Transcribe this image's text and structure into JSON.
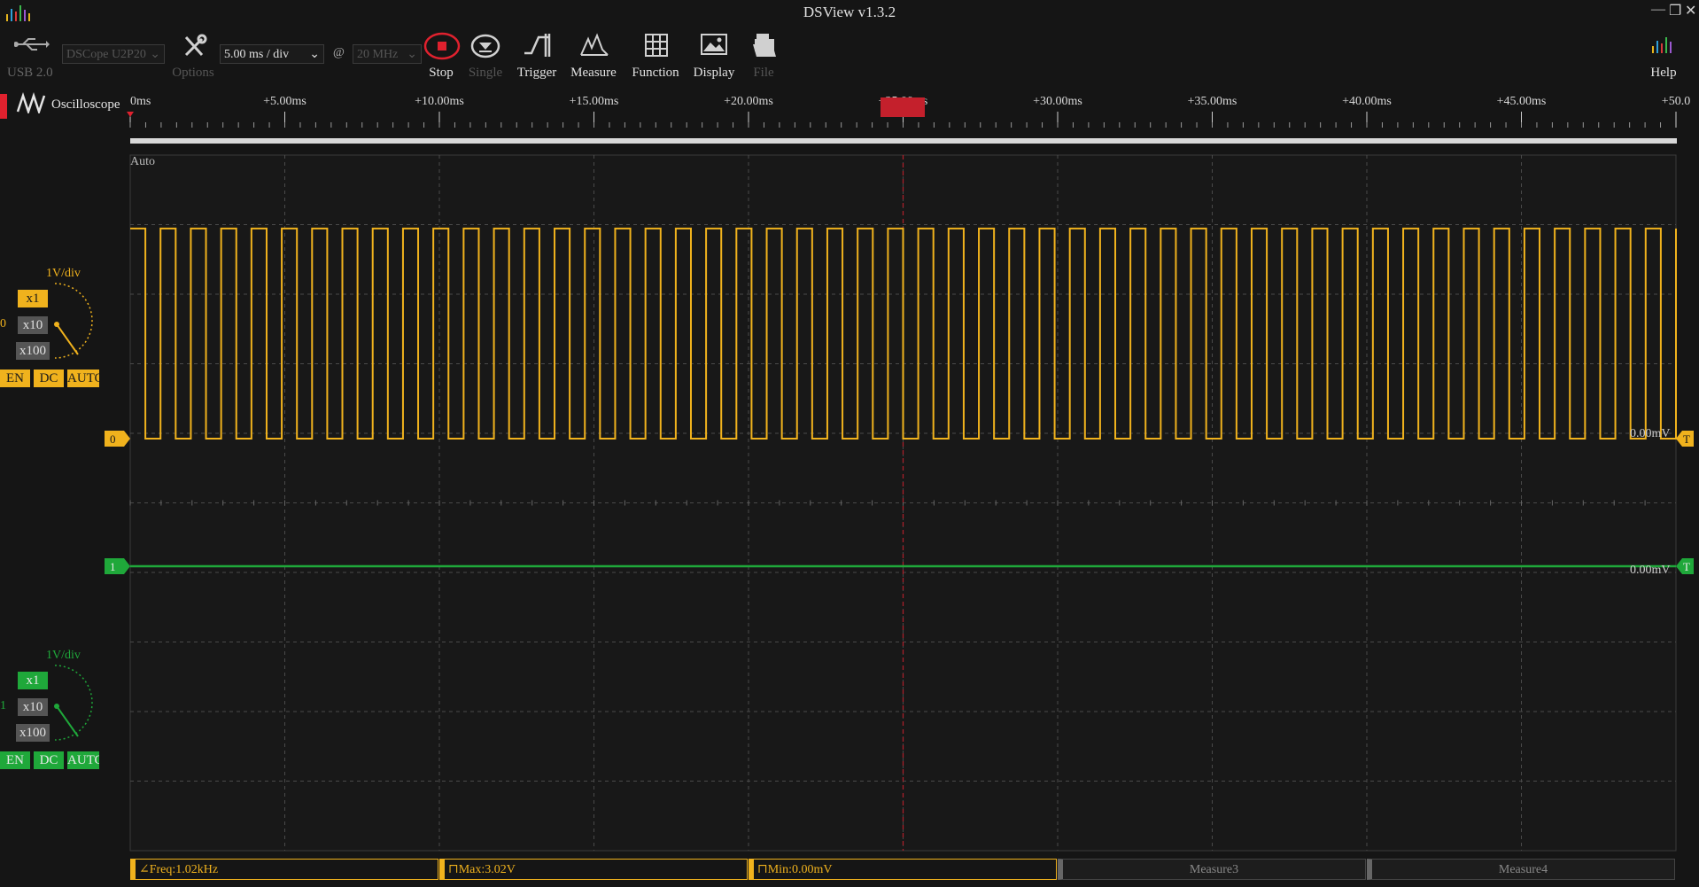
{
  "window": {
    "title": "DSView v1.3.2"
  },
  "toolbar": {
    "usb_label": "USB 2.0",
    "device": "DSCope U2P20",
    "timebase": "5.00 ms / div",
    "at": "@",
    "bandwidth": "20 MHz",
    "options_label": "Options",
    "stop_label": "Stop",
    "single_label": "Single",
    "trigger_label": "Trigger",
    "measure_label": "Measure",
    "function_label": "Function",
    "display_label": "Display",
    "file_label": "File",
    "help_label": "Help"
  },
  "mode": {
    "label": "Oscilloscope"
  },
  "ruler": {
    "labels": [
      "0ms",
      "+5.00ms",
      "+10.00ms",
      "+15.00ms",
      "+20.00ms",
      "+25.00ms",
      "+30.00ms",
      "+35.00ms",
      "+40.00ms",
      "+45.00ms",
      "+50.0"
    ]
  },
  "plot": {
    "trigger_mode": "Auto"
  },
  "channels": [
    {
      "index": "0",
      "color": "#f0b21d",
      "vdiv": "1V/div",
      "probes": [
        "x1",
        "x10",
        "x100"
      ],
      "en": "EN",
      "coupling": "DC",
      "auto": "AUTO",
      "offset_readout": "0.00mV",
      "trigger_tag": "T",
      "frequency_khz": 1.02,
      "high_v": 3.02,
      "low_v": 0.0
    },
    {
      "index": "1",
      "color": "#1fa83a",
      "vdiv": "1V/div",
      "probes": [
        "x1",
        "x10",
        "x100"
      ],
      "en": "EN",
      "coupling": "DC",
      "auto": "AUTO",
      "offset_readout": "0.00mV",
      "trigger_tag": "T"
    }
  ],
  "measurements": [
    {
      "label": "Freq:1.02kHz",
      "active": true
    },
    {
      "label": "Max:3.02V",
      "active": true
    },
    {
      "label": "Min:0.00mV",
      "active": true
    },
    {
      "label": "Measure3",
      "active": false
    },
    {
      "label": "Measure4",
      "active": false
    }
  ]
}
